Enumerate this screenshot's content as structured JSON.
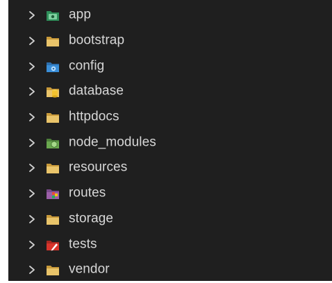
{
  "explorer": {
    "items": [
      {
        "label": "app",
        "icon": "folder-app-icon"
      },
      {
        "label": "bootstrap",
        "icon": "folder-icon"
      },
      {
        "label": "config",
        "icon": "folder-config-icon"
      },
      {
        "label": "database",
        "icon": "folder-database-icon"
      },
      {
        "label": "httpdocs",
        "icon": "folder-icon"
      },
      {
        "label": "node_modules",
        "icon": "folder-node-icon"
      },
      {
        "label": "resources",
        "icon": "folder-icon"
      },
      {
        "label": "routes",
        "icon": "folder-routes-icon"
      },
      {
        "label": "storage",
        "icon": "folder-icon"
      },
      {
        "label": "tests",
        "icon": "folder-tests-icon"
      },
      {
        "label": "vendor",
        "icon": "folder-icon"
      }
    ]
  },
  "colors": {
    "background": "#1f1f1f",
    "text": "#d7d7d7",
    "chevron": "#cfcfcf",
    "folder": "#e9c46a",
    "app": "#2f8f5a",
    "config": "#3a8ed8",
    "database": "#f2c230",
    "node": "#6aa84f",
    "routes": "#c0392b",
    "tests": "#d9342b"
  }
}
